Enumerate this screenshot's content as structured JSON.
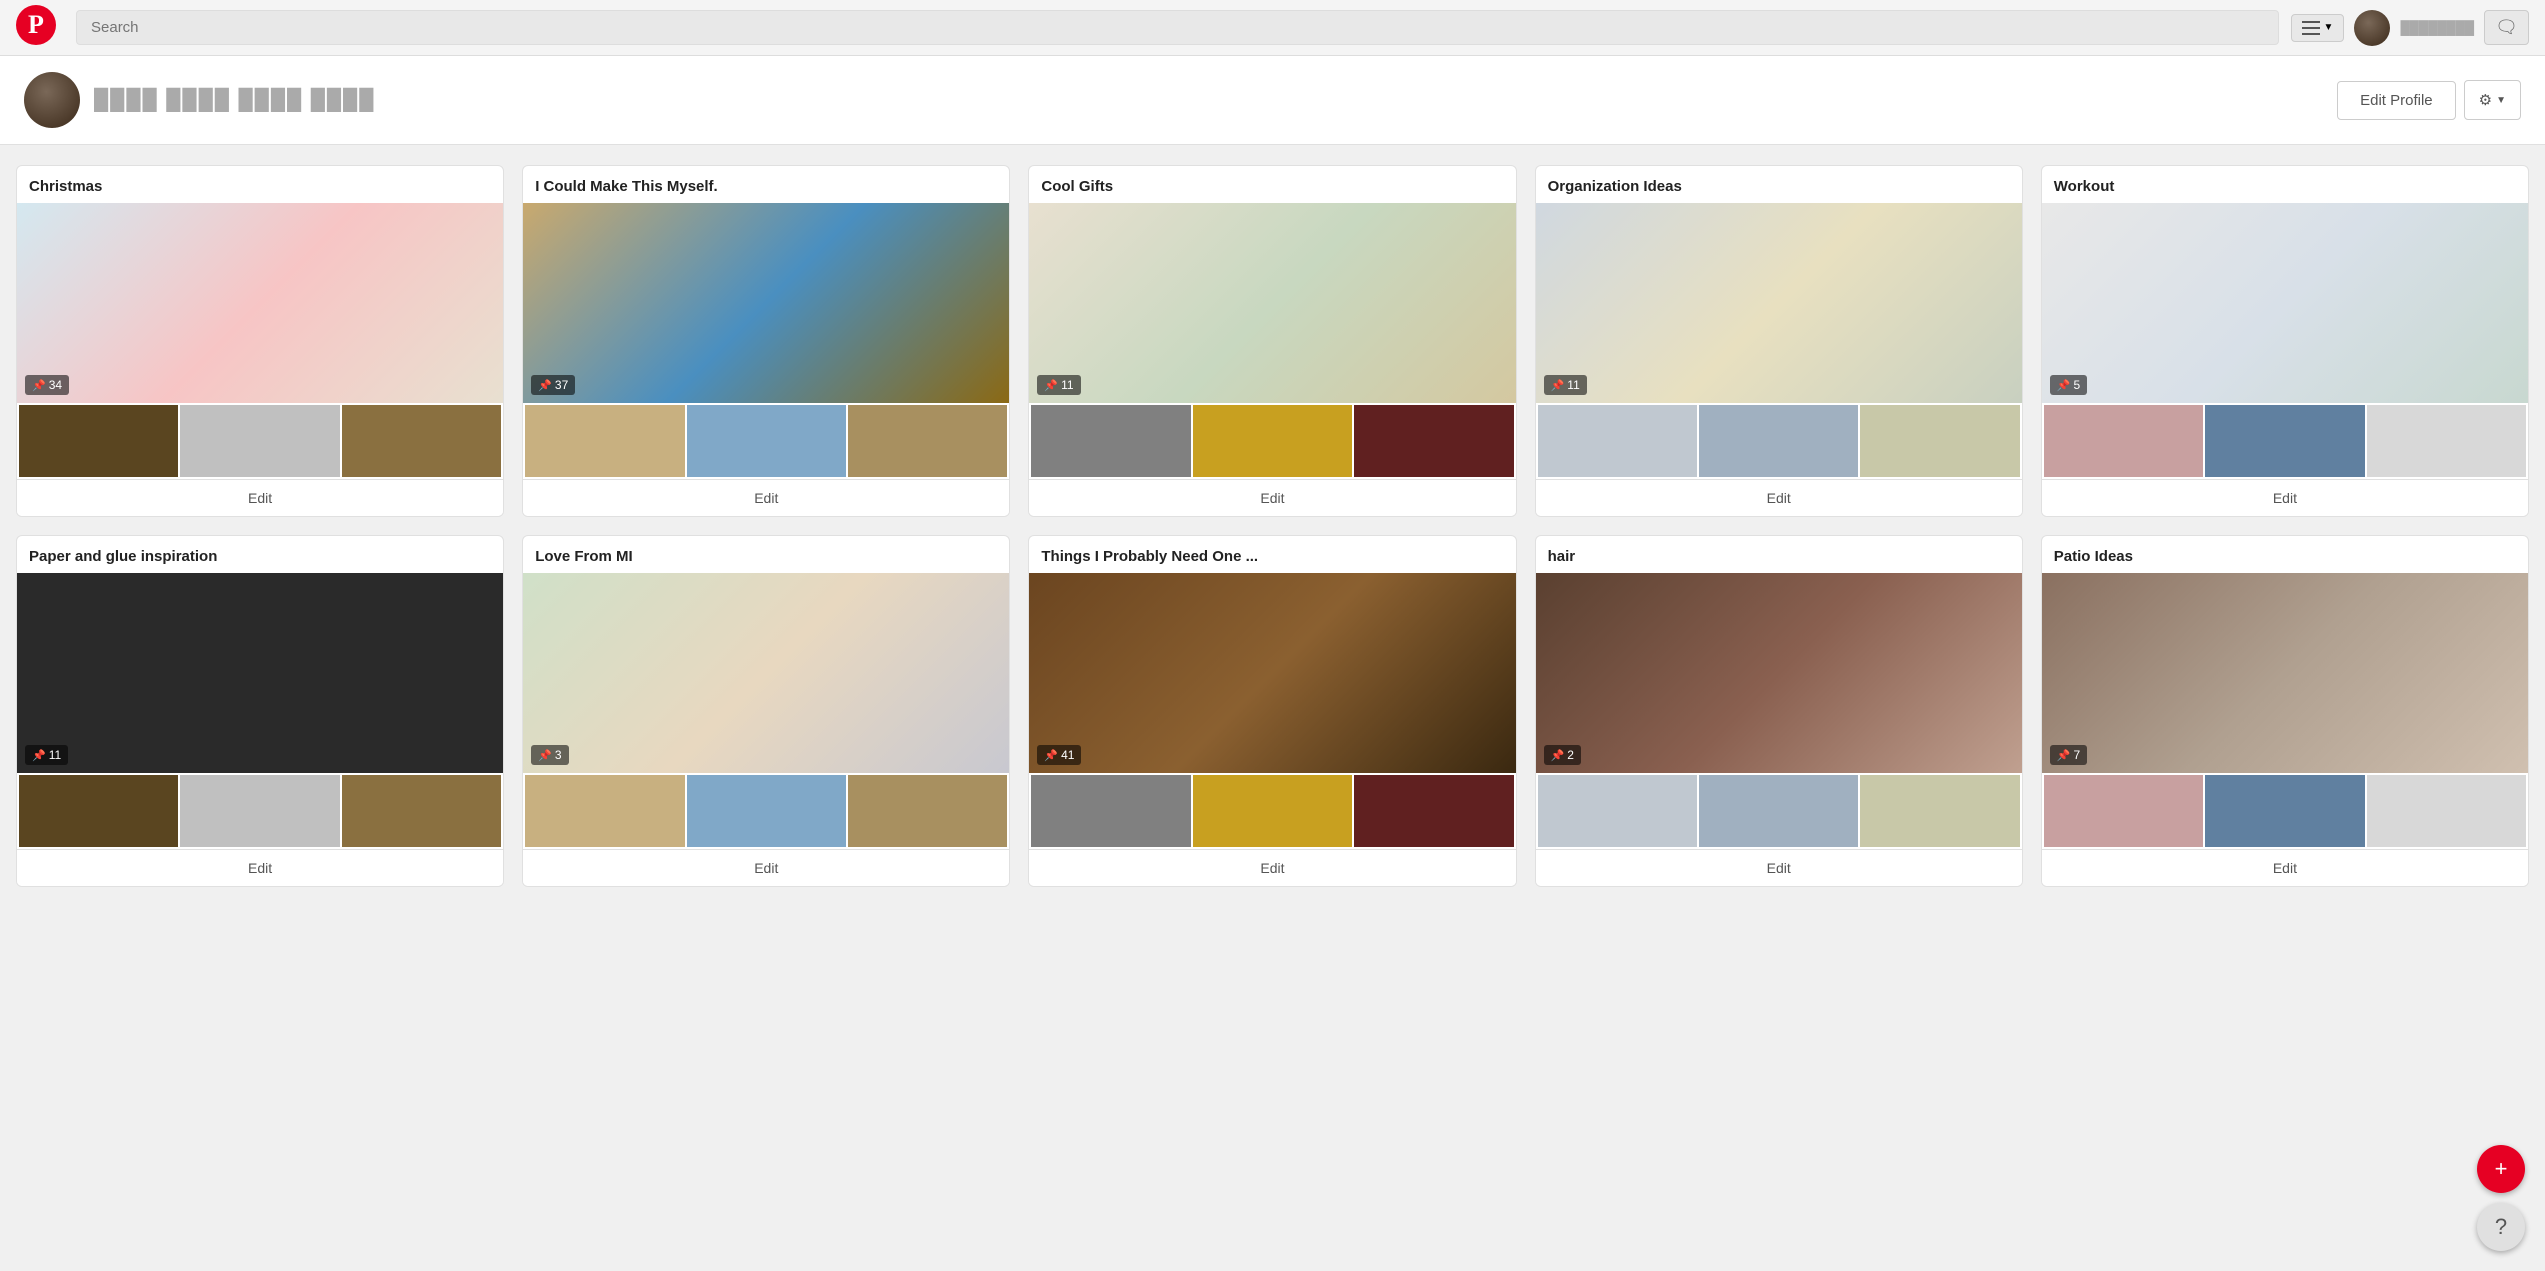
{
  "header": {
    "search_placeholder": "Search",
    "menu_icon": "menu-icon",
    "message_icon": "message-icon",
    "username_display": "username"
  },
  "profile": {
    "name": "User Name",
    "edit_button": "Edit Profile",
    "settings_icon": "⚙"
  },
  "boards": [
    {
      "id": "christmas",
      "title": "Christmas",
      "pin_count": "34",
      "edit_label": "Edit",
      "main_color": "christmas-main",
      "thumbs": [
        "thumb-c1",
        "thumb-c2",
        "thumb-c3"
      ]
    },
    {
      "id": "icmm",
      "title": "I Could Make This Myself.",
      "pin_count": "37",
      "edit_label": "Edit",
      "main_color": "icmm-main",
      "thumbs": [
        "thumb-i1",
        "thumb-i2",
        "thumb-i3"
      ]
    },
    {
      "id": "gifts",
      "title": "Cool Gifts",
      "pin_count": "11",
      "edit_label": "Edit",
      "main_color": "gifts-main",
      "thumbs": [
        "thumb-g1",
        "thumb-g2",
        "thumb-g3"
      ]
    },
    {
      "id": "org",
      "title": "Organization Ideas",
      "pin_count": "11",
      "edit_label": "Edit",
      "main_color": "org-main",
      "thumbs": [
        "thumb-o1",
        "thumb-o2",
        "thumb-o3"
      ]
    },
    {
      "id": "workout",
      "title": "Workout",
      "pin_count": "5",
      "edit_label": "Edit",
      "main_color": "workout-main",
      "thumbs": [
        "thumb-w1",
        "thumb-w2",
        "thumb-w3"
      ]
    },
    {
      "id": "paper",
      "title": "Paper and glue inspiration",
      "pin_count": "11",
      "edit_label": "Edit",
      "main_color": "paper-main",
      "thumbs": [
        "thumb-c1",
        "thumb-c2",
        "thumb-c3"
      ]
    },
    {
      "id": "lovemi",
      "title": "Love From MI",
      "pin_count": "3",
      "edit_label": "Edit",
      "main_color": "lovemi-main",
      "thumbs": [
        "thumb-i1",
        "thumb-i2",
        "thumb-i3"
      ]
    },
    {
      "id": "things",
      "title": "Things I Probably Need One ...",
      "pin_count": "41",
      "edit_label": "Edit",
      "main_color": "things-main",
      "thumbs": [
        "thumb-g1",
        "thumb-g2",
        "thumb-g3"
      ]
    },
    {
      "id": "hair",
      "title": "hair",
      "pin_count": "2",
      "edit_label": "Edit",
      "main_color": "hair-main",
      "thumbs": [
        "thumb-o1",
        "thumb-o2",
        "thumb-o3"
      ]
    },
    {
      "id": "patio",
      "title": "Patio Ideas",
      "pin_count": "7",
      "edit_label": "Edit",
      "main_color": "patio-main",
      "thumbs": [
        "thumb-w1",
        "thumb-w2",
        "thumb-w3"
      ]
    }
  ],
  "fab": {
    "plus_label": "+",
    "help_label": "?"
  }
}
